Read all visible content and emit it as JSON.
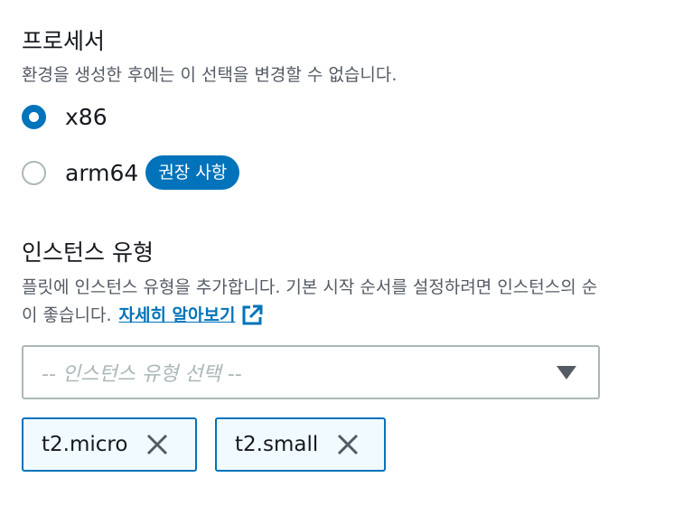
{
  "processor": {
    "title": "프로세서",
    "description": "환경을 생성한 후에는 이 선택을 변경할 수 없습니다.",
    "options": [
      {
        "label": "x86",
        "selected": true
      },
      {
        "label": "arm64",
        "selected": false,
        "badge": "권장 사항"
      }
    ]
  },
  "instance_types": {
    "title": "인스턴스 유형",
    "description_line1": "플릿에 인스턴스 유형을 추가합니다. 기본 시작 순서를 설정하려면 인스턴스의 순",
    "description_line2": "이 좋습니다.",
    "learn_more_label": "자세히 알아보기",
    "learn_more_icon": "external-link-icon",
    "select_placeholder": "-- 인스턴스 유형 선택 --",
    "selected_tokens": [
      {
        "label": "t2.micro",
        "dismiss_icon": "close-icon"
      },
      {
        "label": "t2.small",
        "dismiss_icon": "close-icon"
      }
    ]
  },
  "colors": {
    "accent": "#0073bb",
    "text_primary": "#16191f",
    "text_secondary": "#545b64",
    "border": "#aab7b8",
    "token_background": "#f1faff"
  }
}
